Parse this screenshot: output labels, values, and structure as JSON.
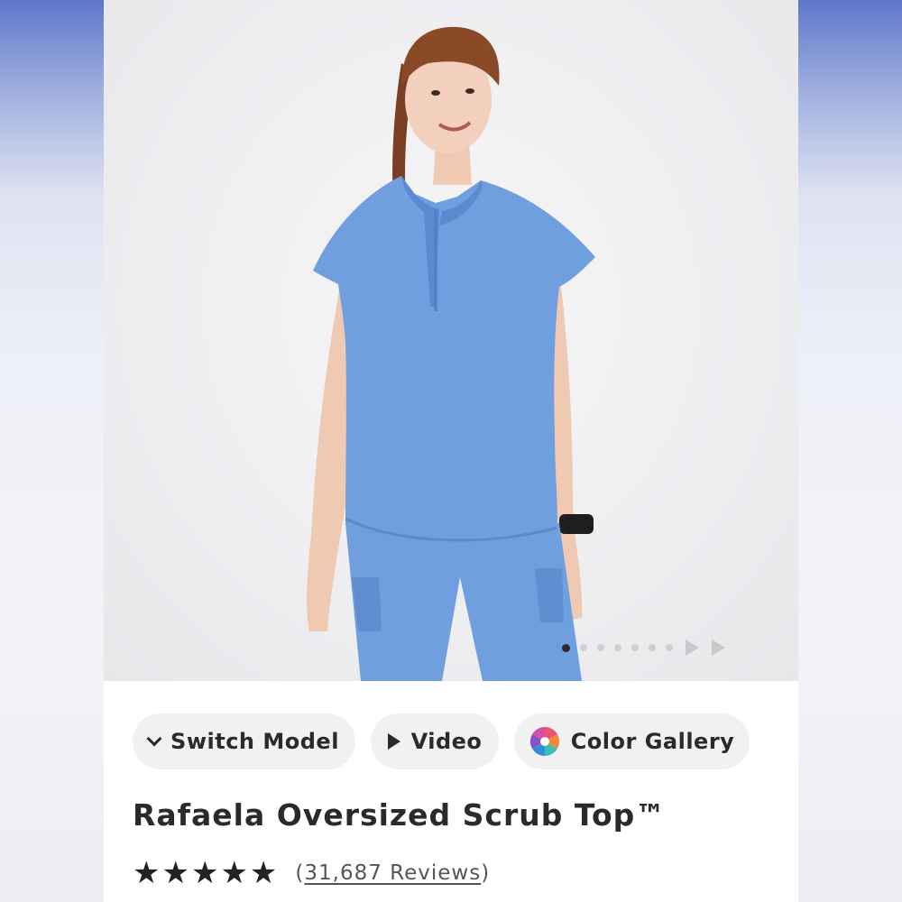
{
  "product": {
    "title": "Rafaela Oversized Scrub Top™",
    "rating": 4.8,
    "rating_stars": "★★★★★",
    "reviews_open": "(",
    "reviews_link": "31,687 Reviews",
    "reviews_close": ")"
  },
  "gallery": {
    "image_count": 7,
    "active_index": 0,
    "icons": [
      "arrow-right-icon",
      "arrow-right-icon"
    ]
  },
  "actions": {
    "switch_model": "Switch Model",
    "video": "Video",
    "color_gallery": "Color Gallery"
  },
  "colors": {
    "scrub_blue": "#6f9fdf",
    "text": "#2a2a2a",
    "pill_bg": "#f1f1f2"
  }
}
